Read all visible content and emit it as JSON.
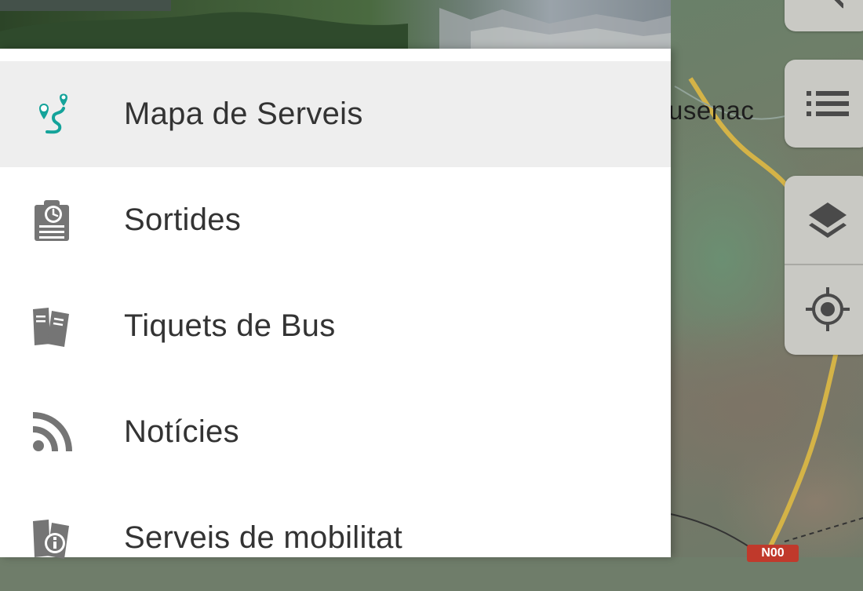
{
  "map": {
    "place_label": "usenac",
    "road_badge": "N00"
  },
  "map_controls": {
    "icons": [
      "search-icon",
      "list-icon",
      "layers-icon",
      "my-location-icon"
    ]
  },
  "drawer": {
    "items": [
      {
        "label": "Mapa de Serveis",
        "icon": "map-route-icon",
        "active": true
      },
      {
        "label": "Sortides",
        "icon": "schedule-board-icon",
        "active": false
      },
      {
        "label": "Tiquets de Bus",
        "icon": "tickets-icon",
        "active": false
      },
      {
        "label": "Notícies",
        "icon": "rss-icon",
        "active": false
      },
      {
        "label": "Serveis de mobilitat",
        "icon": "mobility-info-icon",
        "active": false
      }
    ]
  },
  "colors": {
    "accent": "#14a39a",
    "icon_gray": "#757575",
    "active_row": "#eeeeee",
    "text": "#333333"
  }
}
